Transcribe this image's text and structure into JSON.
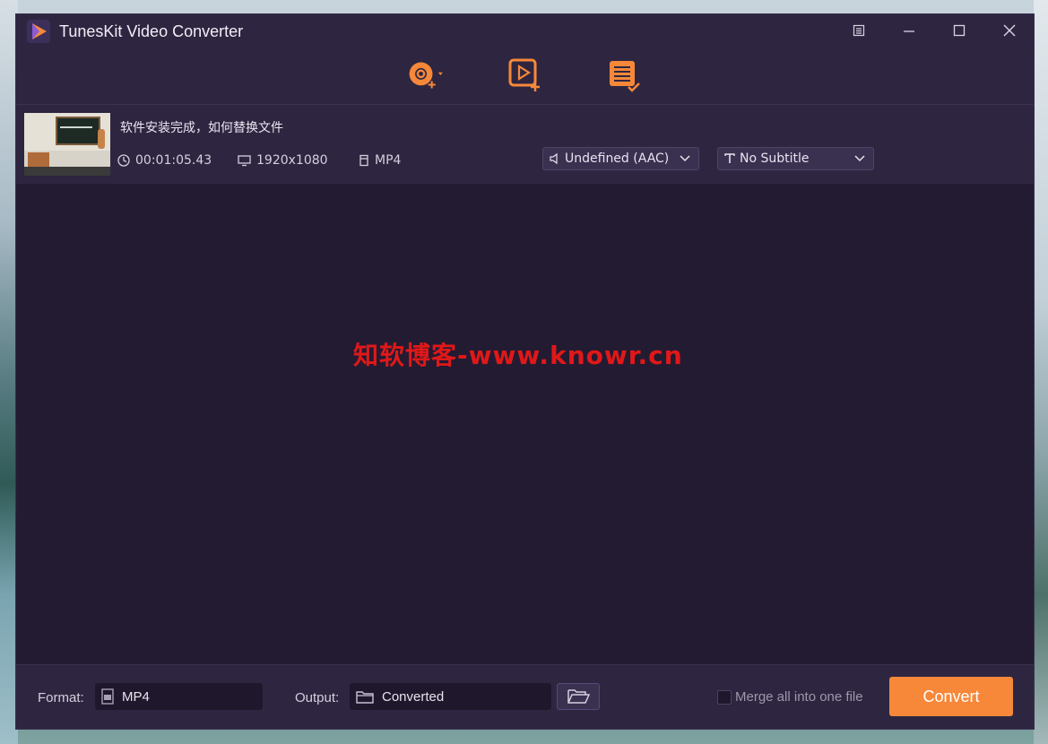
{
  "app": {
    "title": "TunesKit Video Converter"
  },
  "window_controls": {
    "menu_icon": "menu-icon",
    "minimize_icon": "minimize-icon",
    "maximize_icon": "maximize-icon",
    "close_icon": "close-icon"
  },
  "toolbar": {
    "add_dvd_icon": "add-dvd-icon",
    "add_files_icon": "add-video-icon",
    "converted_history_icon": "history-list-icon"
  },
  "file": {
    "name": "软件安装完成，如何替换文件",
    "duration": "00:01:05.43",
    "resolution": "1920x1080",
    "format": "MP4",
    "audio_track": "Undefined (AAC)",
    "subtitle": "No Subtitle"
  },
  "watermark": "知软博客-www.knowr.cn",
  "bottom": {
    "format_label": "Format:",
    "format_value": "MP4",
    "output_label": "Output:",
    "output_value": "Converted",
    "merge_label": "Merge all into one file",
    "merge_checked": false,
    "convert_label": "Convert"
  },
  "colors": {
    "accent": "#f7883a",
    "window_bg": "#241c33",
    "bar_bg": "#2e2640",
    "watermark": "#e01818"
  }
}
